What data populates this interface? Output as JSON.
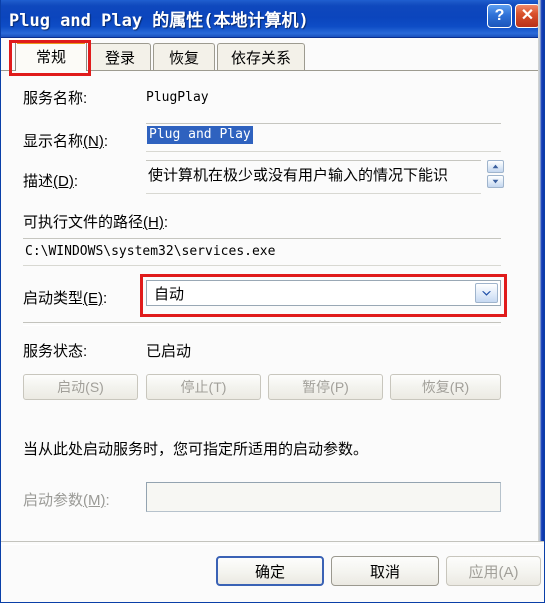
{
  "window": {
    "title": "Plug and Play 的属性(本地计算机)",
    "help_button": "?",
    "close_button": "✕"
  },
  "tabs": [
    {
      "label": "常规",
      "active": true
    },
    {
      "label": "登录",
      "active": false
    },
    {
      "label": "恢复",
      "active": false
    },
    {
      "label": "依存关系",
      "active": false
    }
  ],
  "general": {
    "service_name_label": "服务名称:",
    "service_name_value": "PlugPlay",
    "display_name_label": "显示名称",
    "display_name_acc": "(N)",
    "display_name_suffix": ":",
    "display_name_value": "Plug and Play",
    "description_label": "描述",
    "description_acc": "(D)",
    "description_suffix": ":",
    "description_value": "使计算机在极少或没有用户输入的情况下能识",
    "path_label": "可执行文件的路径",
    "path_acc": "(H)",
    "path_suffix": ":",
    "path_value": "C:\\WINDOWS\\system32\\services.exe",
    "startup_type_label": "启动类型",
    "startup_type_acc": "(E)",
    "startup_type_suffix": ":",
    "startup_type_value": "自动",
    "service_status_label": "服务状态:",
    "service_status_value": "已启动",
    "buttons": [
      {
        "label": "启动(S)",
        "disabled": true
      },
      {
        "label": "停止(T)",
        "disabled": true
      },
      {
        "label": "暂停(P)",
        "disabled": true
      },
      {
        "label": "恢复(R)",
        "disabled": true
      }
    ],
    "hint_text": "当从此处启动服务时，您可指定所适用的启动参数。",
    "start_params_label": "启动参数",
    "start_params_acc": "(M)",
    "start_params_suffix": ":",
    "start_params_value": ""
  },
  "dialog_buttons": {
    "ok": "确定",
    "cancel": "取消",
    "apply": "应用(A)"
  },
  "colors": {
    "titlebar_blue": "#0b45bd",
    "accent_orange": "#f5a623",
    "annotation_red": "#e01b1b",
    "selection_blue": "#2f62bf",
    "dialog_bg": "#fbfbfb"
  }
}
